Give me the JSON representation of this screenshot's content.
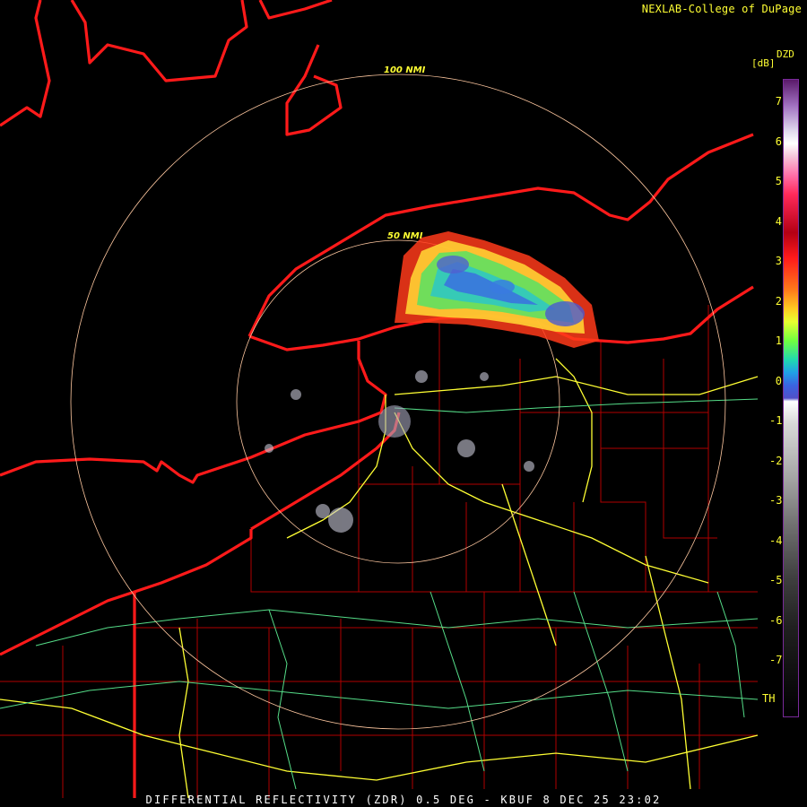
{
  "header": {
    "credit": "NEXLAB-College of DuPage"
  },
  "legend": {
    "title": "DZD",
    "unit": "[dB]",
    "ticks": [
      "7",
      "6",
      "5",
      "4",
      "3",
      "2",
      "1",
      "0",
      "-1",
      "-2",
      "-3",
      "-4",
      "-5",
      "-6",
      "-7"
    ],
    "threshold": "TH"
  },
  "rings": {
    "outer": "100 NMI",
    "inner": "50 NMI"
  },
  "footer": {
    "caption": "DIFFERENTIAL REFLECTIVITY (ZDR) 0.5 DEG - KBUF 8 DEC 25 23:02"
  },
  "colors": {
    "border": "#ff1a1a",
    "county": "#c00000",
    "highway": "#ffff33",
    "road": "#66ff99",
    "ring": "#ffc8a0"
  }
}
